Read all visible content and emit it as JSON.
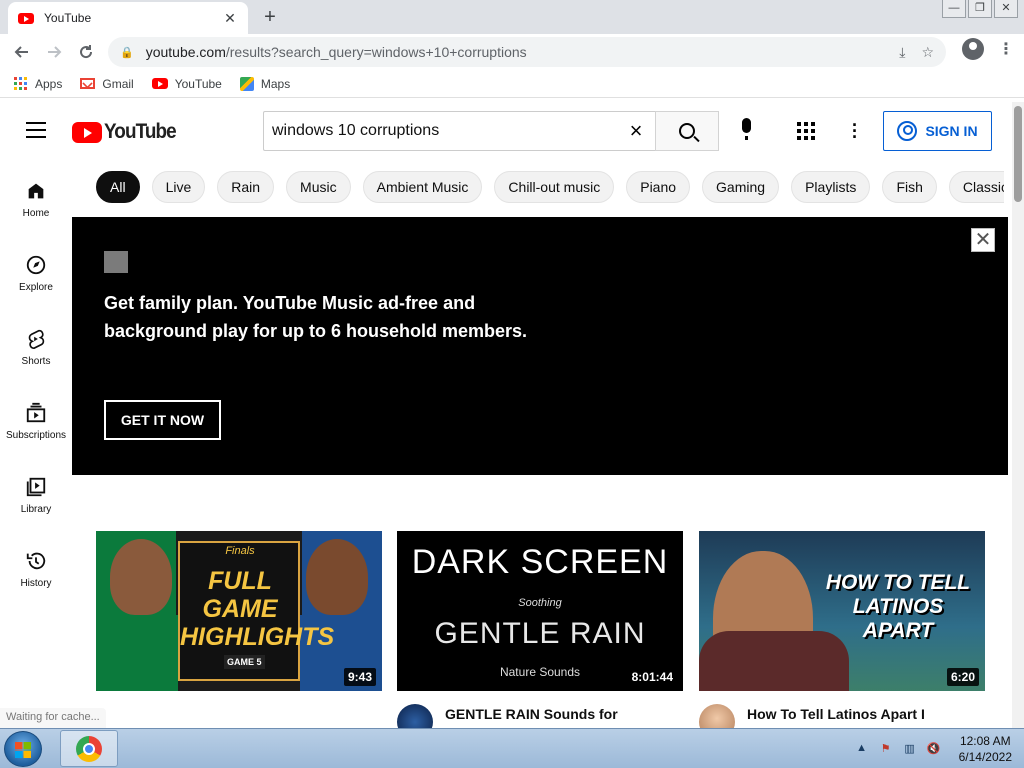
{
  "browser": {
    "tab_title": "YouTube",
    "tab_close": "✕",
    "new_tab": "+",
    "url_host": "youtube.com",
    "url_path": "/results?search_query=windows+10+corruptions",
    "bookmarks": [
      {
        "label": "Apps",
        "icon": "apps-grid-icon"
      },
      {
        "label": "Gmail",
        "icon": "gmail-icon"
      },
      {
        "label": "YouTube",
        "icon": "youtube-icon"
      },
      {
        "label": "Maps",
        "icon": "maps-icon"
      }
    ],
    "status_text": "Waiting for cache..."
  },
  "header": {
    "logo_text": "YouTube",
    "search_value": "windows 10 corruptions",
    "signin_label": "SIGN IN"
  },
  "sidebar": {
    "items": [
      {
        "label": "Home",
        "icon": "home-icon"
      },
      {
        "label": "Explore",
        "icon": "compass-icon"
      },
      {
        "label": "Shorts",
        "icon": "shorts-icon"
      },
      {
        "label": "Subscriptions",
        "icon": "subscriptions-icon"
      },
      {
        "label": "Library",
        "icon": "library-icon"
      },
      {
        "label": "History",
        "icon": "history-icon"
      }
    ]
  },
  "chips": [
    "All",
    "Live",
    "Rain",
    "Music",
    "Ambient Music",
    "Chill-out music",
    "Piano",
    "Gaming",
    "Playlists",
    "Fish",
    "Classic"
  ],
  "promo": {
    "text": "Get family plan. YouTube Music ad-free and background play for up to 6 household members.",
    "cta": "GET IT NOW",
    "close": "✕"
  },
  "videos": [
    {
      "title": "",
      "duration": "9:43",
      "thumb_text": {
        "finals": "Finals",
        "headline": "FULL GAME HIGHLIGHTS",
        "game": "GAME 5"
      }
    },
    {
      "title": "GENTLE RAIN Sounds for",
      "duration": "8:01:44",
      "thumb_text": {
        "l1": "DARK SCREEN",
        "l2": "Soothing",
        "l3": "GENTLE RAIN",
        "l4": "Nature Sounds"
      }
    },
    {
      "title": "How To Tell Latinos Apart I",
      "duration": "6:20",
      "thumb_text": {
        "headline": "HOW TO TELL LATINOS APART"
      }
    }
  ],
  "taskbar": {
    "time": "12:08 AM",
    "date": "6/14/2022"
  },
  "colors": {
    "brand_red": "#ff0000",
    "link_blue": "#065fd4",
    "chip_active": "#0f0f0f"
  }
}
